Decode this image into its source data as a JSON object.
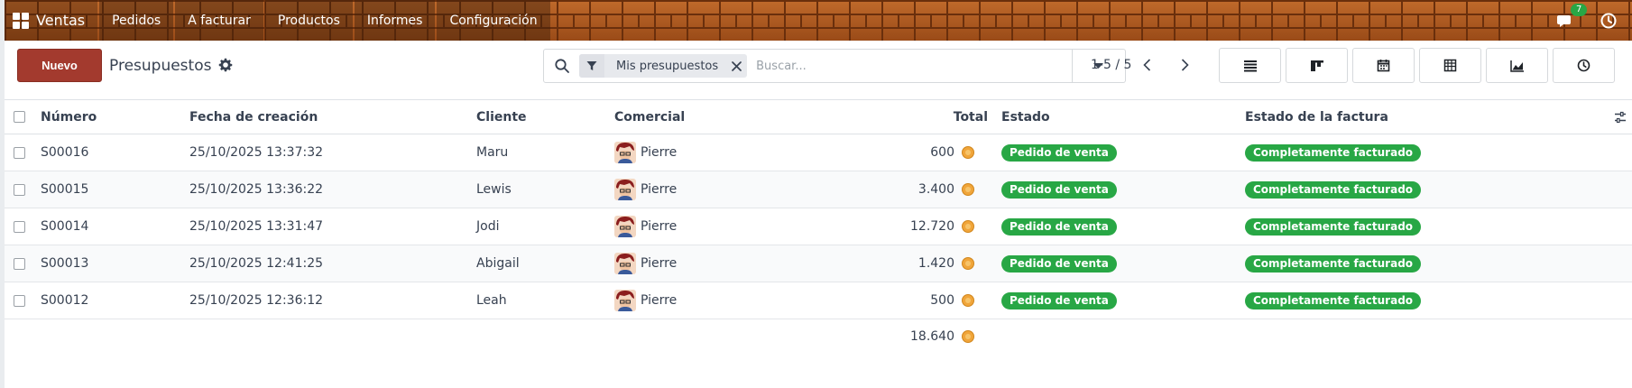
{
  "nav": {
    "app_name": "Ventas",
    "items": [
      "Pedidos",
      "A facturar",
      "Productos",
      "Informes",
      "Configuración"
    ],
    "chat_count": "7"
  },
  "control": {
    "new_label": "Nuevo",
    "title": "Presupuestos",
    "search": {
      "facet": "Mis presupuestos",
      "placeholder": "Buscar..."
    },
    "pager": "1-5 / 5",
    "views": [
      "list-icon",
      "kanban-icon",
      "calendar-icon",
      "pivot-icon",
      "graph-icon",
      "activity-icon"
    ]
  },
  "table": {
    "columns": {
      "number": "Número",
      "created": "Fecha de creación",
      "customer": "Cliente",
      "salesperson": "Comercial",
      "total": "Total",
      "status": "Estado",
      "invoice_status": "Estado de la factura"
    },
    "rows": [
      {
        "number": "S00016",
        "created": "25/10/2025 13:37:32",
        "customer": "Maru",
        "salesperson": "Pierre",
        "total": "600",
        "status": "Pedido de venta",
        "invoice_status": "Completamente facturado"
      },
      {
        "number": "S00015",
        "created": "25/10/2025 13:36:22",
        "customer": "Lewis",
        "salesperson": "Pierre",
        "total": "3.400",
        "status": "Pedido de venta",
        "invoice_status": "Completamente facturado"
      },
      {
        "number": "S00014",
        "created": "25/10/2025 13:31:47",
        "customer": "Jodi",
        "salesperson": "Pierre",
        "total": "12.720",
        "status": "Pedido de venta",
        "invoice_status": "Completamente facturado"
      },
      {
        "number": "S00013",
        "created": "25/10/2025 12:41:25",
        "customer": "Abigail",
        "salesperson": "Pierre",
        "total": "1.420",
        "status": "Pedido de venta",
        "invoice_status": "Completamente facturado"
      },
      {
        "number": "S00012",
        "created": "25/10/2025 12:36:12",
        "customer": "Leah",
        "salesperson": "Pierre",
        "total": "500",
        "status": "Pedido de venta",
        "invoice_status": "Completamente facturado"
      }
    ],
    "grand_total": "18.640"
  },
  "colors": {
    "primary": "#a33a2e",
    "success": "#28a745",
    "coin": "#f0a53a",
    "nav_brick": "#a2521d"
  }
}
